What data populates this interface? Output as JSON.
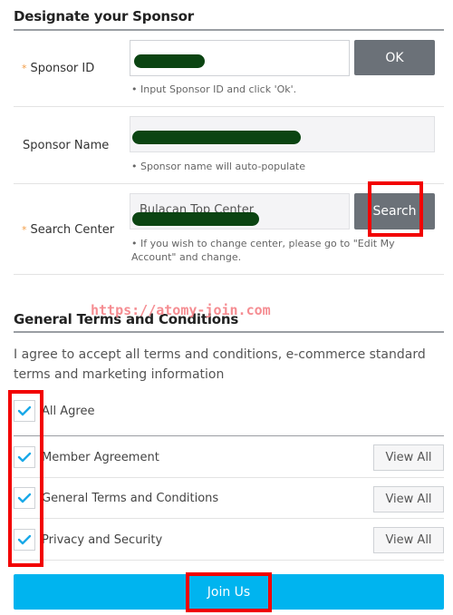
{
  "sponsor_section": {
    "title": "Designate your Sponsor",
    "required_mark": "*",
    "sponsor_id": {
      "label": "Sponsor ID",
      "value": "(redacted)",
      "ok_button": "OK",
      "hint": "• Input Sponsor ID and click 'Ok'."
    },
    "sponsor_name": {
      "label": "Sponsor Name",
      "value": "(redacted)",
      "hint": "• Sponsor name will auto-populate"
    },
    "search_center": {
      "label": "Search Center",
      "value": "Bulacan Top Center",
      "search_button": "Search",
      "hint": "• If you wish to change center, please go to \"Edit My Account\" and change."
    }
  },
  "watermark": "https://atomy-join.com",
  "terms_section": {
    "title": "General Terms and Conditions",
    "description": "I agree to accept all terms and conditions, e-commerce standard terms and marketing information",
    "all_agree": {
      "label": "All Agree",
      "checked": true
    },
    "items": [
      {
        "label": "Member Agreement",
        "checked": true,
        "button": "View All"
      },
      {
        "label": "General Terms and Conditions",
        "checked": true,
        "button": "View All"
      },
      {
        "label": "Privacy and Security",
        "checked": true,
        "button": "View All"
      }
    ]
  },
  "join_button": "Join Us",
  "colors": {
    "accent": "#00b4ef",
    "check": "#1aa9e8",
    "required": "#f39c44",
    "button_gray": "#6b7178",
    "annotation_red": "#f20000"
  }
}
